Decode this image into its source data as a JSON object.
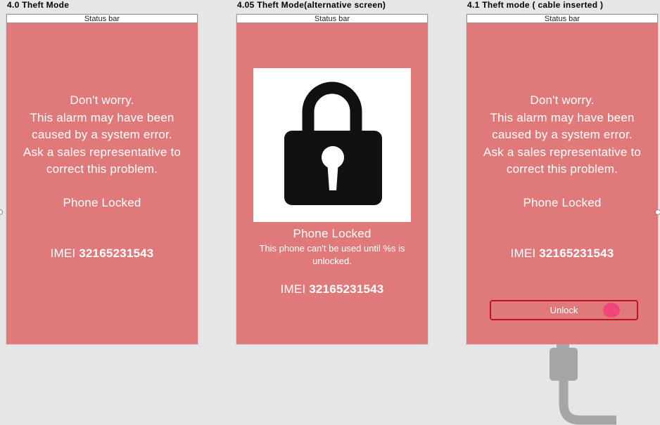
{
  "frames": [
    {
      "title": "4.0 Theft Mode",
      "status_bar": "Status bar",
      "message_lines": [
        "Don't worry.",
        "This alarm may have been",
        "caused by a system error.",
        "Ask a sales representative to",
        "correct this problem."
      ],
      "locked_label": "Phone Locked",
      "imei_label": "IMEI",
      "imei_number": "32165231543"
    },
    {
      "title": "4.05 Theft Mode(alternative screen)",
      "status_bar": "Status bar",
      "lock_icon": "padlock-icon",
      "locked_label": "Phone Locked",
      "subtext_lines": [
        "This phone can't be used until %s is",
        "unlocked."
      ],
      "imei_label": "IMEI",
      "imei_number": "32165231543"
    },
    {
      "title": "4.1 Theft mode ( cable inserted )",
      "status_bar": "Status bar",
      "message_lines": [
        "Don't worry.",
        "This alarm may have been",
        "caused by a system error.",
        "Ask a sales representative to",
        "correct this problem."
      ],
      "locked_label": "Phone Locked",
      "imei_label": "IMEI",
      "imei_number": "32165231543",
      "unlock_label": "Unlock",
      "cable_icon": "usb-cable-icon"
    }
  ],
  "colors": {
    "screen_bg": "#e07a7a",
    "canvas_bg": "#e6e6e6",
    "unlock_border": "#c0141c",
    "unlock_knob": "#f0457c",
    "cable": "#a6a6a6"
  }
}
